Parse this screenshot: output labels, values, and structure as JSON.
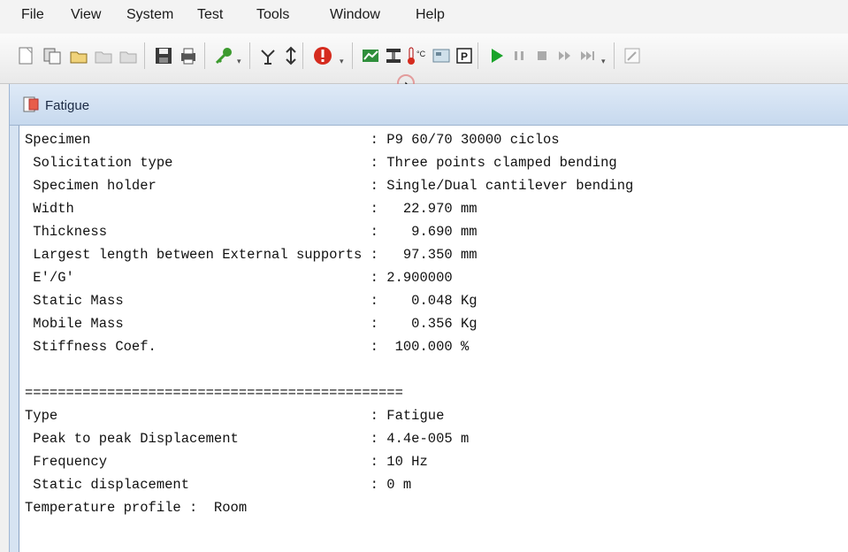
{
  "menu": [
    "File",
    "View",
    "System",
    "Test",
    "Tools",
    "Window",
    "Help"
  ],
  "toolbar_icons": [
    "new-file-icon",
    "copy-icon",
    "open-folder-icon",
    "open-disabled-icon",
    "open-disabled-icon",
    "save-icon",
    "print-icon",
    "key-icon",
    "antenna-icon",
    "vertical-arrow-icon",
    "stop-alert-icon",
    "chart-icon",
    "clamp-icon",
    "temperature-icon",
    "display-icon",
    "p-box-icon",
    "play-icon",
    "pause-icon",
    "stop-icon",
    "forward-icon",
    "fast-forward-icon",
    "edit-icon"
  ],
  "window": {
    "title": "Fatigue",
    "icon": "document-icon"
  },
  "lines": [
    "Specimen                                  : P9 60/70 30000 ciclos",
    " Solicitation type                        : Three points clamped bending",
    " Specimen holder                          : Single/Dual cantilever bending",
    " Width                                    :   22.970 mm",
    " Thickness                                :    9.690 mm",
    " Largest length between External supports :   97.350 mm",
    " E'/G'                                    : 2.900000",
    " Static Mass                              :    0.048 Kg",
    " Mobile Mass                              :    0.356 Kg",
    " Stiffness Coef.                          :  100.000 %",
    "",
    "==============================================",
    "Type                                      : Fatigue",
    " Peak to peak Displacement                : 4.4e-005 m",
    " Frequency                                : 10 Hz",
    " Static displacement                      : 0 m",
    "Temperature profile :  Room"
  ],
  "colors": {
    "accent_red": "#d52b1e",
    "play_green": "#1aa32a",
    "title_bar": "#c7d9ee"
  }
}
